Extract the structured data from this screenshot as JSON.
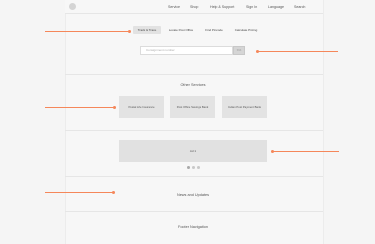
{
  "header": {
    "nav": [
      {
        "label": "Service"
      },
      {
        "label": "Shop"
      },
      {
        "label": "Help & Support"
      },
      {
        "label": "Sign In"
      },
      {
        "label": "Language"
      },
      {
        "label": "Search"
      }
    ]
  },
  "tabs": [
    {
      "label": "Track & Trace",
      "active": true
    },
    {
      "label": "Locate Post Office",
      "active": false
    },
    {
      "label": "Find Pincode",
      "active": false
    },
    {
      "label": "Calculate Pricing",
      "active": false
    }
  ],
  "search": {
    "placeholder": "Consignment number",
    "button_label": ">>>"
  },
  "other_services": {
    "title": "Other Services",
    "cards": [
      {
        "label": "Postal Life Insurance"
      },
      {
        "label": "Post Office Savings Bank"
      },
      {
        "label": "Indian Post Payment Bank"
      }
    ]
  },
  "ad": {
    "label": "Ad 1",
    "slide_count": 3,
    "active_slide": 1
  },
  "news": {
    "title": "News and Updates"
  },
  "footer": {
    "title": "Footer Navigation"
  },
  "colors": {
    "annotation_arrow": "#f5875a",
    "background": "#f5f5f5",
    "card": "#e3e3e3"
  }
}
